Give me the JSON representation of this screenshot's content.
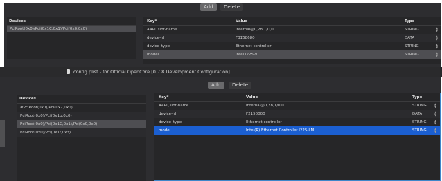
{
  "top_panel": {
    "add_label": "Add",
    "delete_label": "Delete",
    "devices_header": "Devices",
    "devices": [
      {
        "label": "PciRoot(0x0)/Pci(0x1C,0x1)/Pci(0x0,0x0)",
        "selected": true
      }
    ],
    "table_headers": {
      "key": "Key*",
      "value": "Value",
      "type": "Type"
    },
    "rows": [
      {
        "key": "AAPL,slot-name",
        "value": "Internal@0,28,1/0,0",
        "type": "STRING"
      },
      {
        "key": "device-id",
        "value": "F3158680",
        "type": "DATA"
      },
      {
        "key": "device_type",
        "value": "Ethernet controller",
        "type": "STRING"
      },
      {
        "key": "model",
        "value": "Intel I225-V",
        "type": "STRING",
        "selected": true
      }
    ]
  },
  "window_title": "config.plist - for Official OpenCore [0.7.8 Development Configuration]",
  "bottom_panel": {
    "add_label": "Add",
    "delete_label": "Delete",
    "devices_header": "Devices",
    "devices": [
      {
        "label": "#PciRoot(0x0)/Pci(0x2,0x0)"
      },
      {
        "label": "PciRoot(0x0)/Pci(0x1b,0x0)"
      },
      {
        "label": "PciRoot(0x0)/Pci(0x1C,0x1)/Pci(0x0,0x0)",
        "selected": true
      },
      {
        "label": "PciRoot(0x0)/Pci(0x1f,0x3)"
      }
    ],
    "table_headers": {
      "key": "Key*",
      "value": "Value",
      "type": "Type"
    },
    "rows": [
      {
        "key": "AAPL,slot-name",
        "value": "Internal@0,28,1/0,0",
        "type": "STRING"
      },
      {
        "key": "device-id",
        "value": "F2150000",
        "type": "DATA"
      },
      {
        "key": "device_type",
        "value": "Ethernet controller",
        "type": "STRING"
      },
      {
        "key": "model",
        "value": "Intel(R) Ethernet Controller I225-LM",
        "type": "STRING",
        "selected": true
      }
    ]
  },
  "colors": {
    "panel_bg": "#2d2d30",
    "selection_blue": "#1b5fd1",
    "selection_gray": "#4e4e52",
    "focus_border": "#3f86c9"
  },
  "icons": {
    "document": "document-icon",
    "type_stepper": "updown-stepper-icon"
  }
}
